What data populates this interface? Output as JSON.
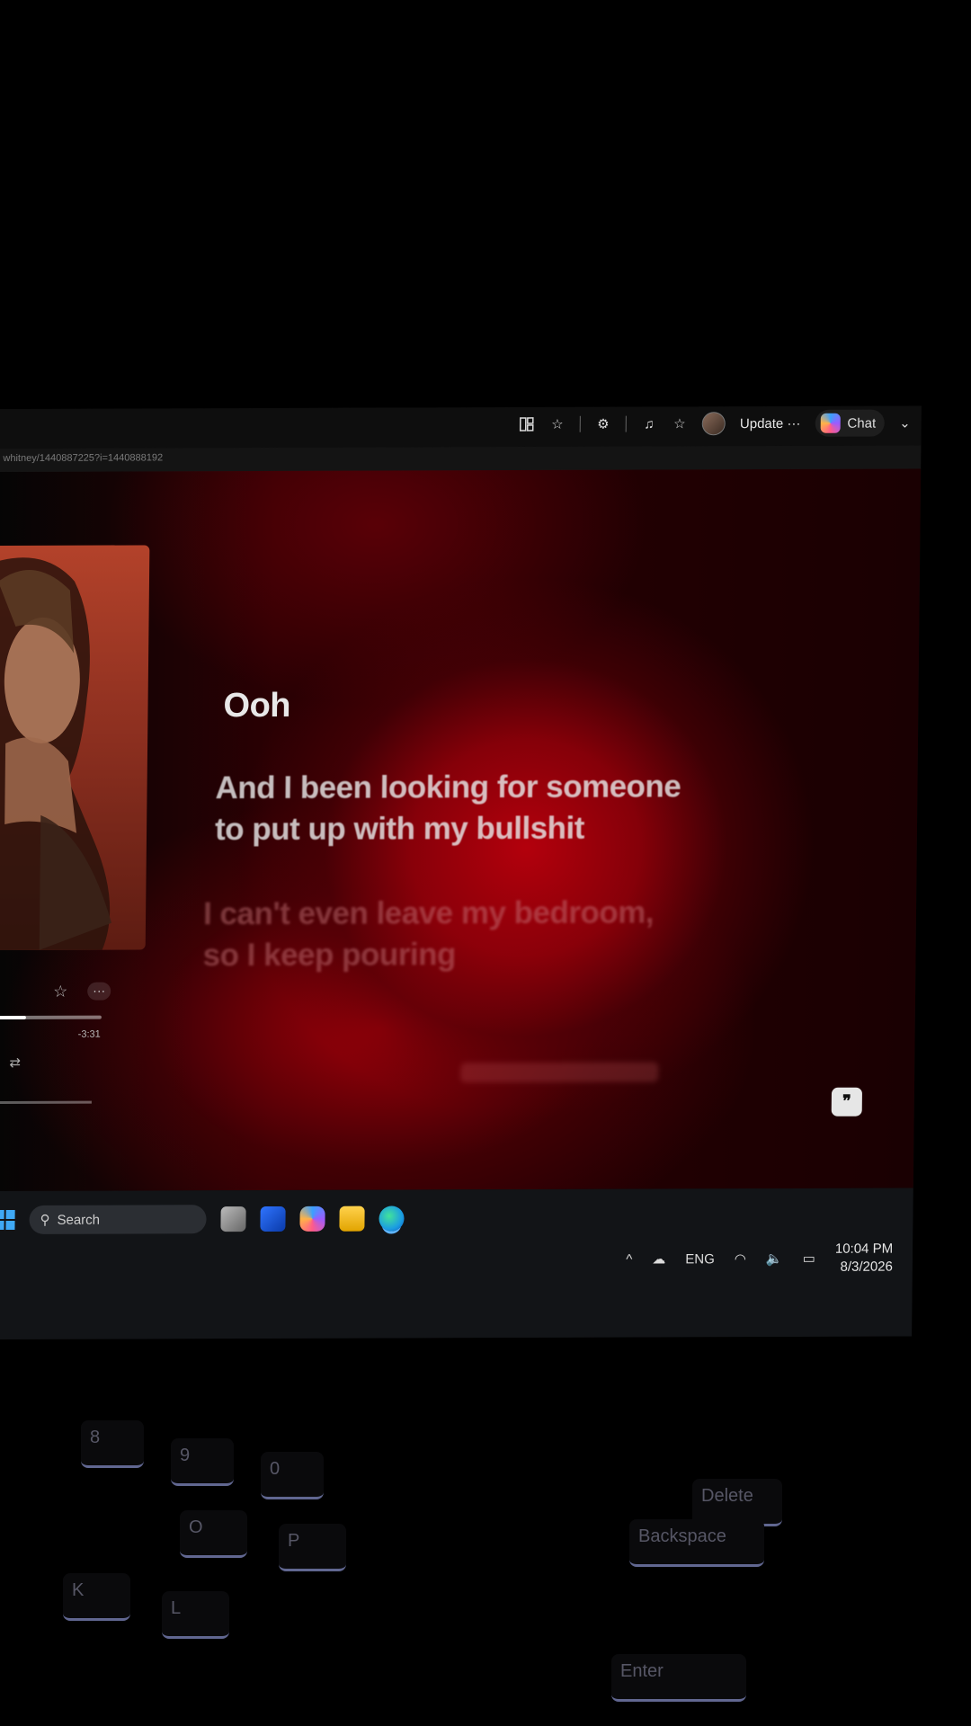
{
  "window": {
    "controls": [
      "—",
      "❐",
      "✕"
    ],
    "url": "whitney/1440887225?i=1440888192"
  },
  "toolbar": {
    "icons": [
      "split-screen-icon",
      "favorite-star-icon",
      "extensions-icon",
      "media-control-icon",
      "favorites-icon",
      "profile-avatar"
    ],
    "update_label": "Update",
    "update_more": "···",
    "chat_label": "Chat",
    "chevron": "⌄"
  },
  "player": {
    "star_glyph": "☆",
    "more_glyph": "···",
    "time_remaining": "-3:31",
    "repeat_glyph": "⇄"
  },
  "lyrics": {
    "current": "Ooh",
    "next_line1": "And I been looking for someone",
    "next_line2": "to put up with my bullshit",
    "later_line1": "I can't even leave my bedroom,",
    "later_line2": "so I keep pouring"
  },
  "quote_button_glyph": "❞",
  "taskbar": {
    "search_placeholder": "Search",
    "apps": [
      "notepad-app",
      "store-app",
      "copilot-app",
      "file-explorer-app",
      "edge-app"
    ],
    "tray": {
      "chevron": "^",
      "language": "ENG",
      "time": "10:04 PM",
      "date": "8/3/2026"
    }
  },
  "keyboard": {
    "keys": [
      "8",
      "9",
      "0",
      "O",
      "P",
      "K",
      "L",
      "Delete",
      "Backspace",
      "Enter"
    ]
  }
}
